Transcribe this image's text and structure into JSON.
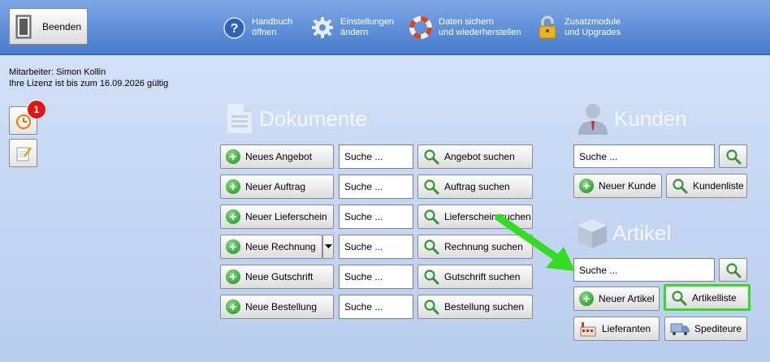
{
  "toolbar": {
    "exit_label": "Beenden",
    "help_line1": "Handbuch",
    "help_line2": "öffnen",
    "settings_line1": "Einstellungen",
    "settings_line2": "ändern",
    "backup_line1": "Daten sichern",
    "backup_line2": "und wiederherstellen",
    "addons_line1": "Zusatzmodule",
    "addons_line2": "und Upgrades"
  },
  "info": {
    "employee": "Mitarbeiter: Simon Kollin",
    "license": "Ihre Lizenz ist bis zum 16.09.2026 gültig"
  },
  "sidebar": {
    "reminder_badge": "1"
  },
  "documents": {
    "title": "Dokumente",
    "search_placeholder": "Suche ...",
    "rows": [
      {
        "new_label": "Neues Angebot",
        "search_label": "Angebot suchen"
      },
      {
        "new_label": "Neuer Auftrag",
        "search_label": "Auftrag suchen"
      },
      {
        "new_label": "Neuer Lieferschein",
        "search_label": "Lieferschein suchen"
      },
      {
        "new_label": "Neue Rechnung",
        "search_label": "Rechnung suchen"
      },
      {
        "new_label": "Neue Gutschrift",
        "search_label": "Gutschrift suchen"
      },
      {
        "new_label": "Neue Bestellung",
        "search_label": "Bestellung suchen"
      }
    ]
  },
  "customers": {
    "title": "Kunden",
    "search_placeholder": "Suche ...",
    "new_label": "Neuer Kunde",
    "list_label": "Kundenliste"
  },
  "articles": {
    "title": "Artikel",
    "search_placeholder": "Suche ...",
    "new_label": "Neuer Artikel",
    "list_label": "Artikelliste",
    "suppliers_label": "Lieferanten",
    "forwarders_label": "Spediteure"
  },
  "colors": {
    "toolbar": "#5c8dd8",
    "highlight": "#33dd22",
    "background": "#c9daf5"
  }
}
